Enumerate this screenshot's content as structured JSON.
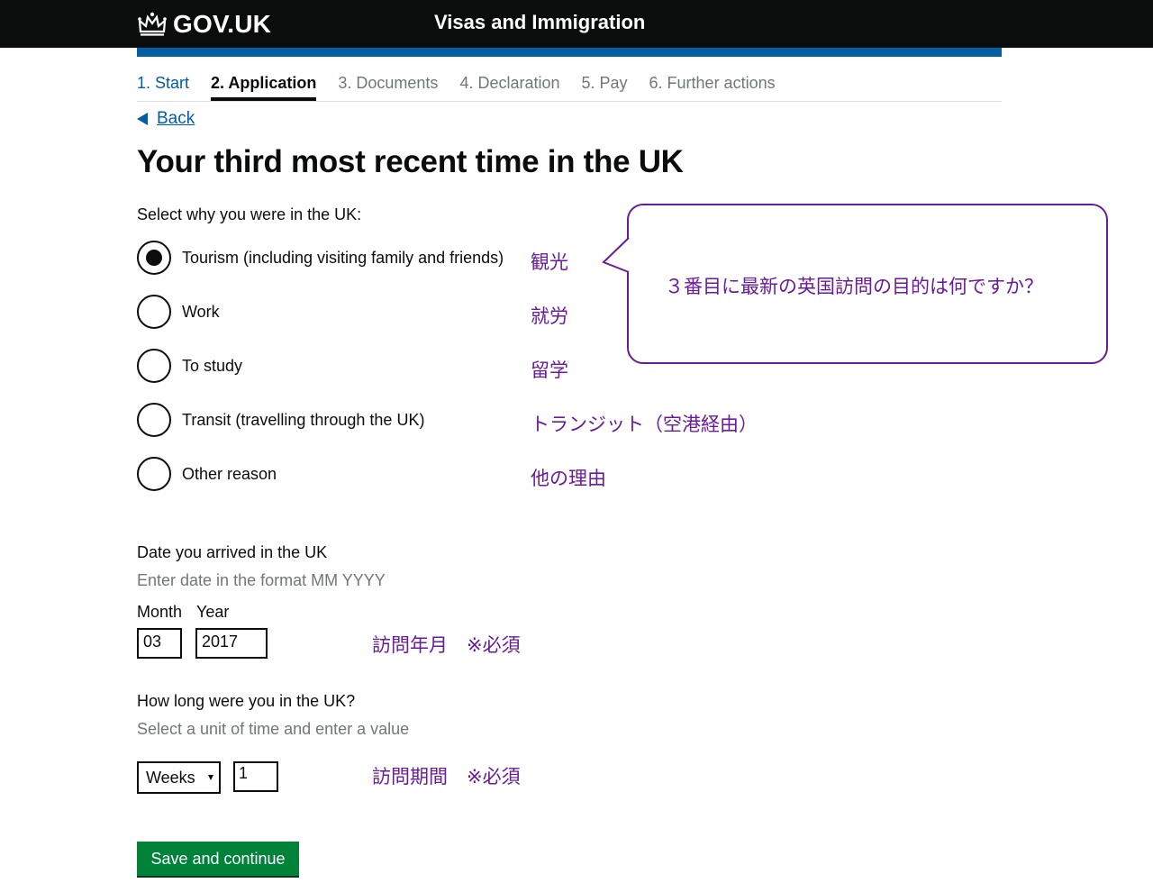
{
  "header": {
    "logo_text": "GOV.UK",
    "service_name": "Visas and Immigration",
    "crown_icon": "crown-icon"
  },
  "steps": [
    {
      "label": "1. Start",
      "state": "done"
    },
    {
      "label": "2. Application",
      "state": "current"
    },
    {
      "label": "3. Documents",
      "state": "future"
    },
    {
      "label": "4. Declaration",
      "state": "future"
    },
    {
      "label": "5. Pay",
      "state": "future"
    },
    {
      "label": "6. Further actions",
      "state": "future"
    }
  ],
  "back_link": "Back",
  "title": "Your third most recent time in the UK",
  "reason": {
    "label": "Select why you were in the UK:",
    "options": [
      {
        "label": "Tourism (including visiting family and friends)",
        "jp": "観光",
        "checked": true
      },
      {
        "label": "Work",
        "jp": "就労",
        "checked": false
      },
      {
        "label": "To study",
        "jp": "留学",
        "checked": false
      },
      {
        "label": "Transit (travelling through the UK)",
        "jp": "トランジット（空港経由）",
        "checked": false
      },
      {
        "label": "Other reason",
        "jp": "他の理由",
        "checked": false
      }
    ]
  },
  "callout": {
    "text": "３番目に最新の英国訪問の目的は何ですか？"
  },
  "arrival": {
    "label": "Date you arrived in the UK",
    "hint": "Enter date in the format MM YYYY",
    "month_label": "Month",
    "year_label": "Year",
    "month_value": "03",
    "year_value": "2017",
    "jp_note": "訪問年月　※必須"
  },
  "duration": {
    "label": "How long were you in the UK?",
    "hint": "Select a unit of time and enter a value",
    "unit_value": "Weeks",
    "amount_value": "1",
    "jp_note": "訪問期間　※必須"
  },
  "submit_label": "Save and continue",
  "colors": {
    "header_bg": "#0b0c0c",
    "blue_bar": "#005ea5",
    "link": "#005ea5",
    "annotation": "#6a1b9a",
    "button": "#00823b"
  }
}
